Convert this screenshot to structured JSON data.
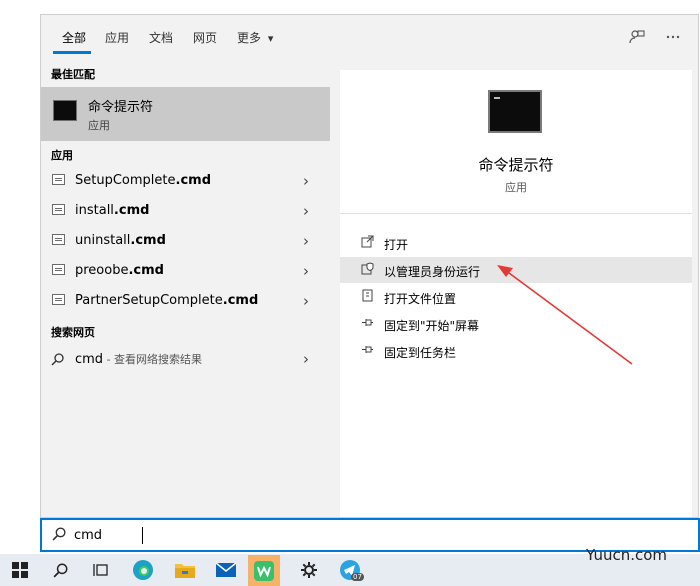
{
  "tabs": {
    "items": [
      {
        "label": "全部",
        "active": true
      },
      {
        "label": "应用"
      },
      {
        "label": "文档"
      },
      {
        "label": "网页"
      },
      {
        "label": "更多"
      }
    ],
    "more_chevron": "▾",
    "feedback_icon": "feedback-icon",
    "options_icon": "more-options-icon"
  },
  "left": {
    "best_match_header": "最佳匹配",
    "best_match": {
      "title": "命令提示符",
      "subtitle": "应用"
    },
    "apps_header": "应用",
    "apps": [
      {
        "name": "SetupComplete",
        "ext": ".cmd"
      },
      {
        "name": "install",
        "ext": ".cmd"
      },
      {
        "name": "uninstall",
        "ext": ".cmd"
      },
      {
        "name": "preoobe",
        "ext": ".cmd"
      },
      {
        "name": "PartnerSetupComplete",
        "ext": ".cmd"
      }
    ],
    "web_header": "搜索网页",
    "web_item": {
      "query": "cmd",
      "suffix": " - 查看网络搜索结果"
    }
  },
  "right": {
    "title": "命令提示符",
    "subtitle": "应用",
    "actions": [
      {
        "label": "打开",
        "icon": "open-icon"
      },
      {
        "label": "以管理员身份运行",
        "icon": "shield-icon",
        "highlighted": true
      },
      {
        "label": "打开文件位置",
        "icon": "file-location-icon"
      },
      {
        "label": "固定到\"开始\"屏幕",
        "icon": "pin-icon"
      },
      {
        "label": "固定到任务栏",
        "icon": "pin-icon"
      }
    ]
  },
  "search": {
    "value": "cmd"
  },
  "taskbar": {
    "badge": "07"
  },
  "watermark": "Yuucn.com",
  "colors": {
    "accent": "#0078d7",
    "arrow": "#e53935"
  }
}
